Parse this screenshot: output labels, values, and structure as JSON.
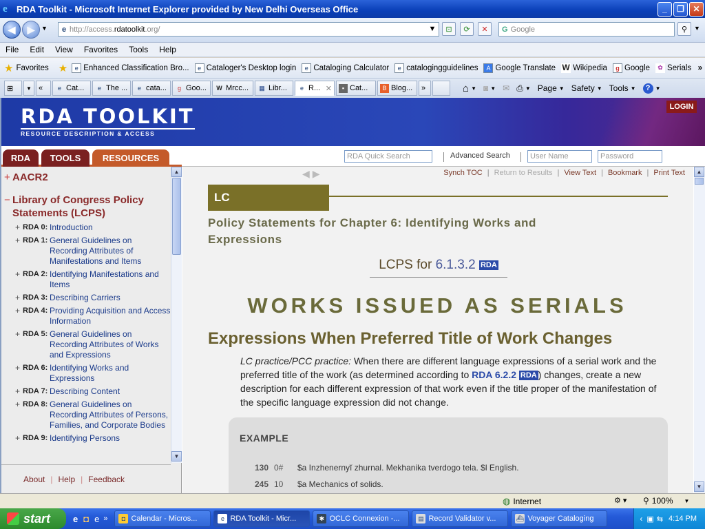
{
  "window": {
    "title": "RDA Toolkit - Microsoft Internet Explorer provided by New Delhi Overseas Office"
  },
  "address_bar": {
    "url_prefix": "http://access.",
    "url_domain": "rdatoolkit",
    "url_suffix": ".org/",
    "search_placeholder": "Google"
  },
  "menu": [
    "File",
    "Edit",
    "View",
    "Favorites",
    "Tools",
    "Help"
  ],
  "favorites": {
    "label": "Favorites",
    "items": [
      "Enhanced Classification Bro...",
      "Cataloger's Desktop login",
      "Cataloging Calculator",
      "catalogingguidelines",
      "Google Translate",
      "Wikipedia",
      "Google",
      "Serials"
    ]
  },
  "tabs": [
    "Cat...",
    "The ...",
    "cata...",
    "Goo...",
    "Mrcc...",
    "Libr...",
    "R...",
    "Cat...",
    "Blog..."
  ],
  "command_bar": [
    "Page",
    "Safety",
    "Tools"
  ],
  "site": {
    "logo": "RDA TOOLKIT",
    "logo_sub": "RESOURCE DESCRIPTION & ACCESS",
    "nav_tabs": [
      "RDA",
      "TOOLS",
      "RESOURCES"
    ],
    "quick_search_placeholder": "RDA Quick Search",
    "advanced_search": "Advanced Search",
    "username_placeholder": "User Name",
    "password_placeholder": "Password",
    "login": "LOGIN"
  },
  "tree": {
    "aacr2": "AACR2",
    "lcps": "Library of Congress Policy Statements (LCPS)",
    "items": [
      {
        "num": "RDA 0:",
        "label": "Introduction"
      },
      {
        "num": "RDA 1:",
        "label": "General Guidelines on Recording Attributes of Manifestations and Items"
      },
      {
        "num": "RDA 2:",
        "label": "Identifying Manifestations and Items"
      },
      {
        "num": "RDA 3:",
        "label": "Describing Carriers"
      },
      {
        "num": "RDA 4:",
        "label": "Providing Acquisition and Access Information"
      },
      {
        "num": "RDA 5:",
        "label": "General Guidelines on Recording Attributes of Works and Expressions"
      },
      {
        "num": "RDA 6:",
        "label": "Identifying Works and Expressions"
      },
      {
        "num": "RDA 7:",
        "label": "Describing Content"
      },
      {
        "num": "RDA 8:",
        "label": "General Guidelines on Recording Attributes of Persons, Families, and Corporate Bodies"
      },
      {
        "num": "RDA 9:",
        "label": "Identifying Persons"
      }
    ]
  },
  "footer_links": [
    "About",
    "Help",
    "Feedback"
  ],
  "content_toolbar": {
    "synch": "Synch TOC",
    "return": "Return to Results",
    "view_text": "View Text",
    "bookmark": "Bookmark",
    "print_text": "Print Text"
  },
  "content": {
    "lc_box": "LC",
    "policy_title": "Policy Statements for Chapter 6: Identifying Works and Expressions",
    "lcps_label": "LCPS for ",
    "lcps_num": "6.1.3.2",
    "rda_badge": "RDA",
    "big_heading": "WORKS ISSUED AS SERIALS",
    "sub_heading": "Expressions When Preferred Title of Work Changes",
    "para_italic": "LC practice/PCC practice:",
    "para_1": " When there are different language expressions of a serial work and the preferred title of the work (as determined according to ",
    "para_link": "RDA 6.2.2",
    "para_2": ") changes, create a new description for each different expression of that work even if the title proper of the manifestation of the specific language expression did not change.",
    "example_label": "EXAMPLE",
    "marc": [
      {
        "tag": "130",
        "ind": "0#",
        "text": "$a Inzhenernyĭ zhurnal. Mekhanika tverdogo tela. $l English."
      },
      {
        "tag": "245",
        "ind": "10",
        "text": "$a Mechanics of solids."
      }
    ]
  },
  "status": {
    "zone": "Internet",
    "zoom": "100%"
  },
  "taskbar": {
    "start": "start",
    "tasks": [
      "Calendar - Micros...",
      "RDA Toolkit - Micr...",
      "OCLC Connexion -...",
      "Record Validator v...",
      "Voyager Cataloging"
    ],
    "time": "4:14 PM"
  }
}
